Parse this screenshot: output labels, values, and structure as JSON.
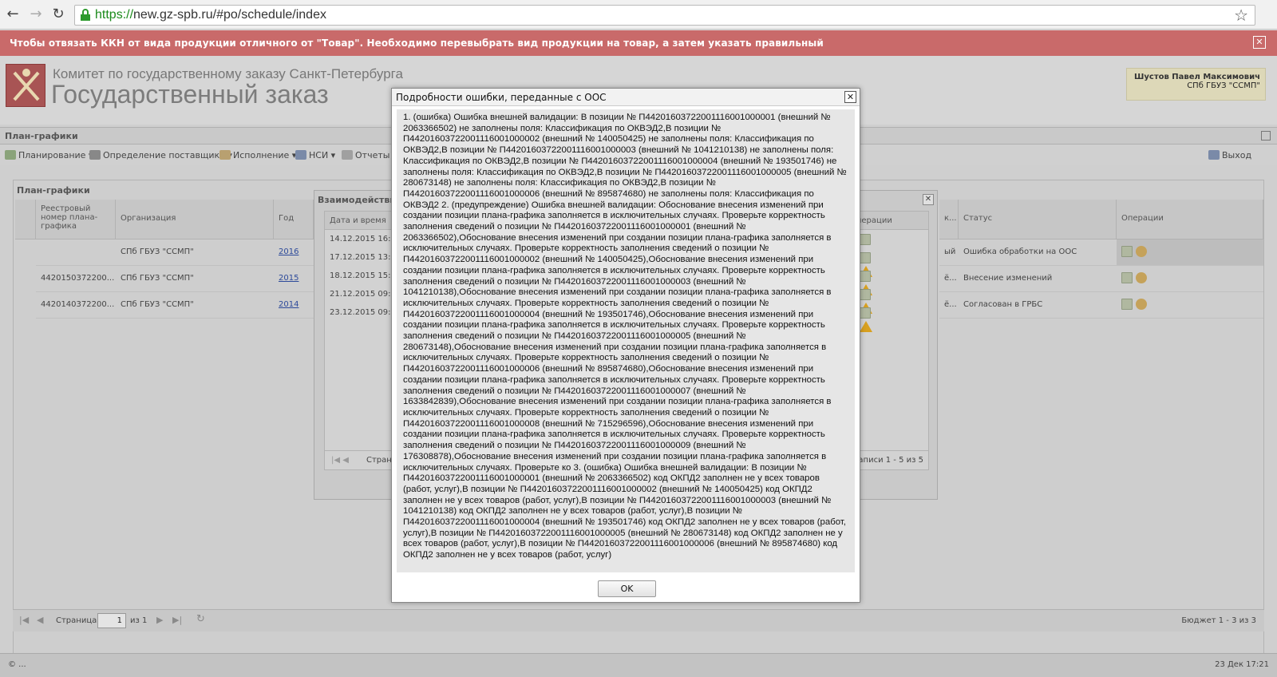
{
  "browser": {
    "url_scheme": "https://",
    "url_rest": "new.gz-spb.ru/#po/schedule/index"
  },
  "notice": {
    "text": "Чтобы отвязать ККН от вида продукции отличного от \"Товар\". Необходимо перевыбрать вид продукции на товар, а затем указать правильный",
    "close_label": "✕"
  },
  "header": {
    "org_line1": "Комитет по государственному заказу Санкт-Петербурга",
    "org_line2": "Государственный заказ",
    "user_name": "Шустов Павел Максимович",
    "user_org": "СПб ГБУЗ \"ССМП\""
  },
  "section": {
    "title": "План-графики"
  },
  "toolbar": {
    "planning": "Планирование ▾",
    "supplier": "Определение поставщика ▾",
    "execution": "Исполнение ▾",
    "nsi": "НСИ ▾",
    "reports": "Отчеты",
    "logout": "Выход"
  },
  "grid": {
    "title": "План-графики",
    "columns": {
      "reg_number": "Реестровый номер плана-графика",
      "organization": "Организация",
      "year": "Год",
      "status": "Статус",
      "operations": "Операции"
    },
    "rows": [
      {
        "reg": "",
        "org": "СПб ГБУЗ \"ССМП\"",
        "year": "2016",
        "col_k": "ый",
        "status": "Ошибка обработки на ООС"
      },
      {
        "reg": "4420150372200...",
        "org": "СПб ГБУЗ \"ССМП\"",
        "year": "2015",
        "col_k": "ё...",
        "status": "Внесение изменений"
      },
      {
        "reg": "4420140372200...",
        "org": "СПб ГБУЗ \"ССМП\"",
        "year": "2014",
        "col_k": "ё...",
        "status": "Согласован в ГРБС"
      }
    ],
    "col_k_header": "к..."
  },
  "bg_dialog": {
    "title": "Взаимодействие",
    "col_datetime": "Дата и время",
    "col_ops": "Операции",
    "rows": [
      "14.12.2015 16:0",
      "17.12.2015 13:1",
      "18.12.2015 15:0",
      "21.12.2015 09:4",
      "23.12.2015 09:3"
    ],
    "paging_left": "Стран",
    "paging_right": "Записи 1 - 5 из 5"
  },
  "paging": {
    "page_label": "Страница",
    "page_value": "1",
    "of_label": "из 1",
    "summary": "Бюджет 1 - 3 из 3"
  },
  "statusbar": {
    "left": "© ...",
    "right": "23 Дек 17:21"
  },
  "modal": {
    "title": "Подробности ошибки, переданные с ООС",
    "close_label": "✕",
    "body": "1. (ошибка) Ошибка внешней валидации: В позиции № П44201603722001116001000001 (внешний № 2063366502) не заполнены поля: Классификация по ОКВЭД2,В позиции № П44201603722001116001000002 (внешний № 140050425) не заполнены поля: Классификация по ОКВЭД2,В позиции № П44201603722001116001000003 (внешний № 1041210138) не заполнены поля: Классификация по ОКВЭД2,В позиции № П44201603722001116001000004 (внешний № 193501746) не заполнены поля: Классификация по ОКВЭД2,В позиции № П44201603722001116001000005 (внешний № 280673148) не заполнены поля: Классификация по ОКВЭД2,В позиции № П44201603722001116001000006 (внешний № 895874680) не заполнены поля: Классификация по ОКВЭД2 2. (предупреждение) Ошибка внешней валидации: Обоснование внесения изменений при создании позиции плана-графика заполняется в исключительных случаях. Проверьте корректность заполнения сведений о позиции № П44201603722001116001000001 (внешний № 2063366502),Обоснование внесения изменений при создании позиции плана-графика заполняется в исключительных случаях. Проверьте корректность заполнения сведений о позиции № П44201603722001116001000002 (внешний № 140050425),Обоснование внесения изменений при создании позиции плана-графика заполняется в исключительных случаях. Проверьте корректность заполнения сведений о позиции № П44201603722001116001000003 (внешний № 1041210138),Обоснование внесения изменений при создании позиции плана-графика заполняется в исключительных случаях. Проверьте корректность заполнения сведений о позиции № П44201603722001116001000004 (внешний № 193501746),Обоснование внесения изменений при создании позиции плана-графика заполняется в исключительных случаях. Проверьте корректность заполнения сведений о позиции № П44201603722001116001000005 (внешний № 280673148),Обоснование внесения изменений при создании позиции плана-графика заполняется в исключительных случаях. Проверьте корректность заполнения сведений о позиции № П44201603722001116001000006 (внешний № 895874680),Обоснование внесения изменений при создании позиции плана-графика заполняется в исключительных случаях. Проверьте корректность заполнения сведений о позиции № П44201603722001116001000007 (внешний № 1633842839),Обоснование внесения изменений при создании позиции плана-графика заполняется в исключительных случаях. Проверьте корректность заполнения сведений о позиции № П44201603722001116001000008 (внешний № 715296596),Обоснование внесения изменений при создании позиции плана-графика заполняется в исключительных случаях. Проверьте корректность заполнения сведений о позиции № П44201603722001116001000009 (внешний № 176308878),Обоснование внесения изменений при создании позиции плана-графика заполняется в исключительных случаях. Проверьте ко 3. (ошибка) Ошибка внешней валидации: В позиции № П44201603722001116001000001 (внешний № 2063366502) код ОКПД2 заполнен не у всех товаров (работ, услуг),В позиции № П44201603722001116001000002 (внешний № 140050425) код ОКПД2 заполнен не у всех товаров (работ, услуг),В позиции № П44201603722001116001000003 (внешний № 1041210138) код ОКПД2 заполнен не у всех товаров (работ, услуг),В позиции № П44201603722001116001000004 (внешний № 193501746) код ОКПД2 заполнен не у всех товаров (работ, услуг),В позиции № П44201603722001116001000005 (внешний № 280673148) код ОКПД2 заполнен не у всех товаров (работ, услуг),В позиции № П44201603722001116001000006 (внешний № 895874680) код ОКПД2 заполнен не у всех товаров (работ, услуг)",
    "ok_label": "OK"
  }
}
